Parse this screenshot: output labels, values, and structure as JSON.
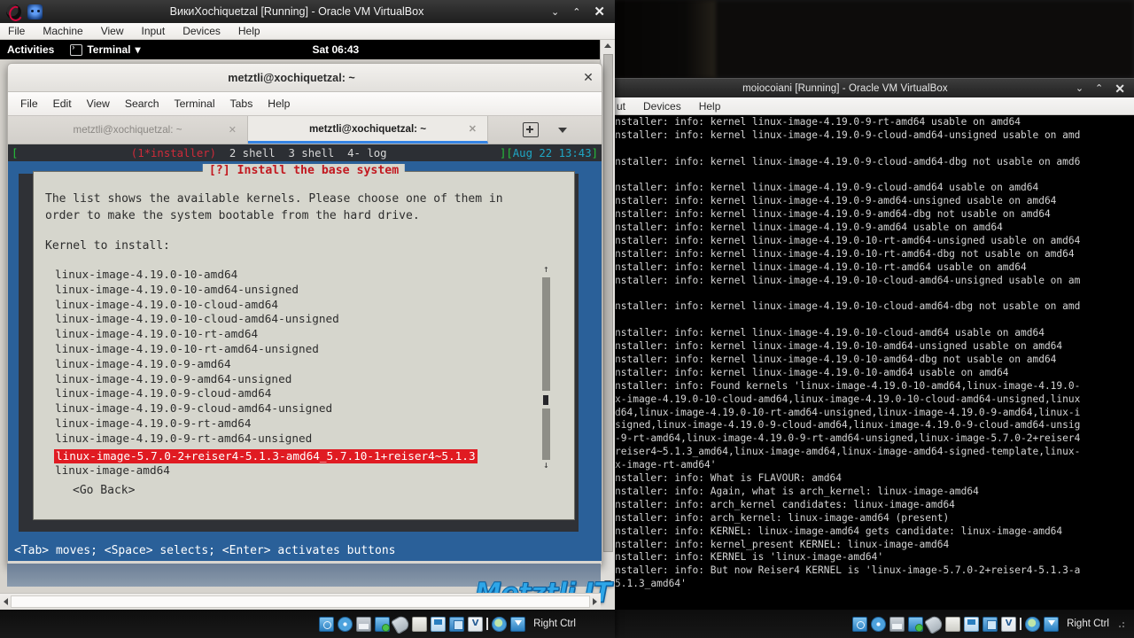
{
  "vm_right": {
    "titlebar": {
      "title": "moiocoiani [Running] - Oracle VM VirtualBox",
      "minimize": "⌄",
      "maximize": "⌃",
      "close": "✕"
    },
    "menubar": [
      "ut",
      "Devices",
      "Help"
    ],
    "log_lines": [
      "nstaller: info: kernel linux-image-4.19.0-9-rt-amd64 usable on amd64",
      "nstaller: info: kernel linux-image-4.19.0-9-cloud-amd64-unsigned usable on amd",
      "",
      "nstaller: info: kernel linux-image-4.19.0-9-cloud-amd64-dbg not usable on amd6",
      "",
      "nstaller: info: kernel linux-image-4.19.0-9-cloud-amd64 usable on amd64",
      "nstaller: info: kernel linux-image-4.19.0-9-amd64-unsigned usable on amd64",
      "nstaller: info: kernel linux-image-4.19.0-9-amd64-dbg not usable on amd64",
      "nstaller: info: kernel linux-image-4.19.0-9-amd64 usable on amd64",
      "nstaller: info: kernel linux-image-4.19.0-10-rt-amd64-unsigned usable on amd64",
      "nstaller: info: kernel linux-image-4.19.0-10-rt-amd64-dbg not usable on amd64",
      "nstaller: info: kernel linux-image-4.19.0-10-rt-amd64 usable on amd64",
      "nstaller: info: kernel linux-image-4.19.0-10-cloud-amd64-unsigned usable on am",
      "",
      "nstaller: info: kernel linux-image-4.19.0-10-cloud-amd64-dbg not usable on amd",
      "",
      "nstaller: info: kernel linux-image-4.19.0-10-cloud-amd64 usable on amd64",
      "nstaller: info: kernel linux-image-4.19.0-10-amd64-unsigned usable on amd64",
      "nstaller: info: kernel linux-image-4.19.0-10-amd64-dbg not usable on amd64",
      "nstaller: info: kernel linux-image-4.19.0-10-amd64 usable on amd64",
      "nstaller: info: Found kernels 'linux-image-4.19.0-10-amd64,linux-image-4.19.0-",
      "x-image-4.19.0-10-cloud-amd64,linux-image-4.19.0-10-cloud-amd64-unsigned,linux",
      "d64,linux-image-4.19.0-10-rt-amd64-unsigned,linux-image-4.19.0-9-amd64,linux-i",
      "signed,linux-image-4.19.0-9-cloud-amd64,linux-image-4.19.0-9-cloud-amd64-unsig",
      "-9-rt-amd64,linux-image-4.19.0-9-rt-amd64-unsigned,linux-image-5.7.0-2+reiser4",
      "reiser4~5.1.3_amd64,linux-image-amd64,linux-image-amd64-signed-template,linux-",
      "x-image-rt-amd64'",
      "nstaller: info: What is FLAVOUR: amd64",
      "nstaller: info: Again, what is arch_kernel: linux-image-amd64",
      "nstaller: info: arch_kernel candidates: linux-image-amd64",
      "nstaller: info: arch_kernel: linux-image-amd64 (present)",
      "nstaller: info: KERNEL: linux-image-amd64 gets candidate: linux-image-amd64",
      "nstaller: info: kernel_present KERNEL: linux-image-amd64",
      "nstaller: info: KERNEL is 'linux-image-amd64'",
      "nstaller: info: But now Reiser4 KERNEL is 'linux-image-5.7.0-2+reiser4-5.1.3-a",
      "5.1.3_amd64'"
    ],
    "statusbar": {
      "host_key": "Right Ctrl",
      "icons": [
        "hard-disk-icon",
        "optical-disk-icon",
        "floppy-icon",
        "network-icon",
        "usb-icon",
        "shared-folder-icon",
        "display-icon",
        "vrde-icon",
        "recording-icon",
        "globe-icon",
        "host-key-icon"
      ]
    }
  },
  "vm_left": {
    "titlebar": {
      "title": "ВикиXochiquetzal [Running] - Oracle VM VirtualBox",
      "minimize": "⌄",
      "maximize": "⌃",
      "close": "✕",
      "icons": [
        "debian-swirl-icon",
        "virtualbox-icon"
      ]
    },
    "menubar": [
      "File",
      "Machine",
      "View",
      "Input",
      "Devices",
      "Help"
    ],
    "gnome_topbar": {
      "activities": "Activities",
      "app_name": "Terminal",
      "app_caret": "▾",
      "clock": "Sat 06:43"
    },
    "terminal": {
      "window_title": "metztli@xochiquetzal: ~",
      "close": "✕",
      "menu": [
        "File",
        "Edit",
        "View",
        "Search",
        "Terminal",
        "Tabs",
        "Help"
      ],
      "tabs": [
        {
          "label": "metztli@xochiquetzal: ~",
          "active": false,
          "close": "✕"
        },
        {
          "label": "metztli@xochiquetzal: ~",
          "active": true,
          "close": "✕"
        }
      ],
      "new_tab_icon": "new-tab-icon",
      "tab_menu_icon": "chevron-down-icon"
    },
    "tmux": {
      "left_bracket": "[",
      "window_active": "(1*installer)",
      "windows": [
        "2 shell",
        "3 shell",
        "4- log"
      ],
      "right_bracket": "]",
      "date_open": "[",
      "date": "Aug 22 13:43",
      "date_close": "]"
    },
    "installer": {
      "title": "[?] Install the base system",
      "body_text": "The list shows the available kernels. Please choose one of them in\norder to make the system bootable from the hard drive.",
      "prompt": "Kernel to install:",
      "kernels": [
        {
          "name": "linux-image-4.19.0-10-amd64",
          "selected": false
        },
        {
          "name": "linux-image-4.19.0-10-amd64-unsigned",
          "selected": false
        },
        {
          "name": "linux-image-4.19.0-10-cloud-amd64",
          "selected": false
        },
        {
          "name": "linux-image-4.19.0-10-cloud-amd64-unsigned",
          "selected": false
        },
        {
          "name": "linux-image-4.19.0-10-rt-amd64",
          "selected": false
        },
        {
          "name": "linux-image-4.19.0-10-rt-amd64-unsigned",
          "selected": false
        },
        {
          "name": "linux-image-4.19.0-9-amd64",
          "selected": false
        },
        {
          "name": "linux-image-4.19.0-9-amd64-unsigned",
          "selected": false
        },
        {
          "name": "linux-image-4.19.0-9-cloud-amd64",
          "selected": false
        },
        {
          "name": "linux-image-4.19.0-9-cloud-amd64-unsigned",
          "selected": false
        },
        {
          "name": "linux-image-4.19.0-9-rt-amd64",
          "selected": false
        },
        {
          "name": "linux-image-4.19.0-9-rt-amd64-unsigned",
          "selected": false
        },
        {
          "name": "linux-image-5.7.0-2+reiser4-5.1.3-amd64_5.7.10-1+reiser4~5.1.3",
          "selected": true
        },
        {
          "name": "linux-image-amd64",
          "selected": false
        }
      ],
      "scroll_up_arrow": "↑",
      "scroll_down_arrow": "↓",
      "go_back_button": "<Go Back>",
      "help_line": "<Tab> moves; <Space> selects; <Enter> activates buttons",
      "colors": {
        "title_red": "#c2181f",
        "selection_red": "#e01b22",
        "background_blue": "#2a6099",
        "dialog_bg": "#d6d6cd"
      }
    },
    "watermark": "Metztli IT",
    "statusbar": {
      "host_key": "Right Ctrl",
      "icons": [
        "hard-disk-icon",
        "optical-disk-icon",
        "floppy-icon",
        "network-icon",
        "usb-icon",
        "shared-folder-icon",
        "display-icon",
        "vrde-icon",
        "recording-icon",
        "globe-icon",
        "host-key-icon"
      ]
    }
  }
}
